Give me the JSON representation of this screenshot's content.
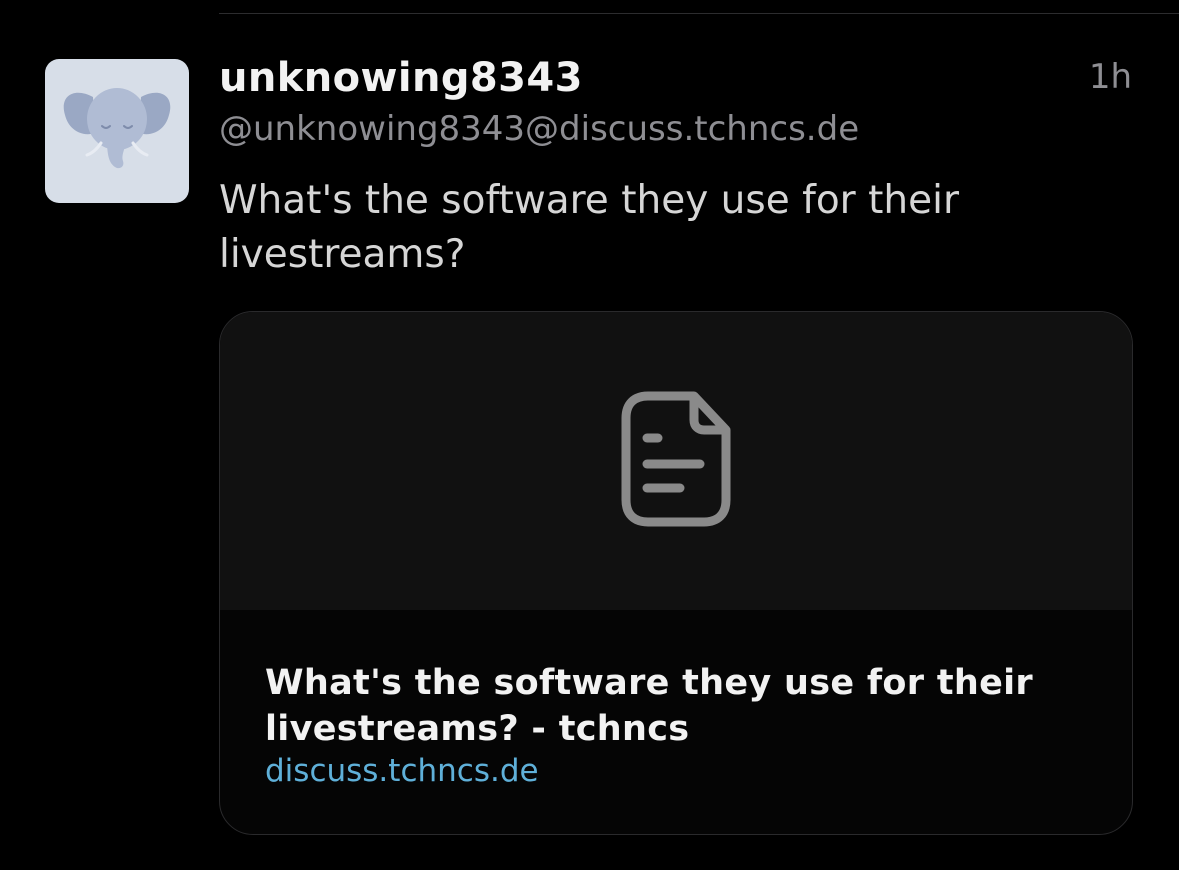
{
  "post": {
    "display_name": "unknowing8343",
    "handle": "@unknowing8343@discuss.tchncs.de",
    "timestamp": "1h",
    "text": "What's the software they use for their livestreams?",
    "avatar_icon": "elephant-icon"
  },
  "link_card": {
    "preview_icon": "document-icon",
    "title": "What's the software they use for their livestreams? - tchncs",
    "domain": "discuss.tchncs.de"
  },
  "colors": {
    "background": "#000000",
    "secondary_text": "#8e8e93",
    "link": "#5fb0d9",
    "avatar_bg": "#d7dee8"
  }
}
